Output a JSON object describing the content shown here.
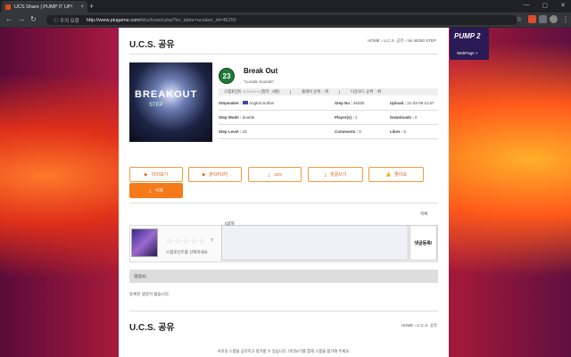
{
  "browser": {
    "tab_title": "UCS Share | PUMP IT UP!",
    "tab_close": "×",
    "new_tab": "+",
    "url_warning": "ⓘ 주의 요함",
    "url_host": "http://www.piugame.com",
    "url_path": "/bbs/board.php?bo_table=ucs&wr_id=46250"
  },
  "header": {
    "title": "U.C.S. 공유",
    "breadcrumb": "HOME  ›  U.C.S. 공유  ›  No.46250 STEP"
  },
  "logo": {
    "text": "PUMP 2",
    "label": "WebPage >"
  },
  "song": {
    "cover_text": "BREAKOUT",
    "cover_sub": "STEP",
    "level": "23",
    "title": "Break Out",
    "subtitle": "\"Lunatic Sounds\"",
    "stats": [
      "스텝포인트 ☆☆☆☆☆ (평가 : 0명)",
      "|",
      "플레이 순위 : -위",
      "|",
      "다운로드 순위 : -위"
    ],
    "stepmaker_label": "Stepmaker :",
    "stepmaker": "AngKimoothie",
    "stepno_label": "Step No :",
    "stepno": "46250",
    "upload_label": "Upload :",
    "upload": "21-02-09 11:57",
    "mode_label": "Step Mode :",
    "mode": "double",
    "players_label": "Player(s) :",
    "players": "1",
    "downloads_label": "Downloads :",
    "downloads": "0",
    "level_label": "Step Level :",
    "level_val": "23",
    "comments_label": "Comments :",
    "comments": "0",
    "likes_label": "Likes :",
    "likes": "0"
  },
  "buttons": {
    "preview": "미리보기",
    "popup": "[POPUP]",
    "ucs": ".ucs",
    "comment": "댓글쓰기",
    "like": "좋아요",
    "delete": "삭제",
    "list": "목록"
  },
  "tabs": {
    "ucs_info": "U.C.S. 설명",
    "comments": "댓글"
  },
  "comment": {
    "stars": "☆☆☆☆☆",
    "star_hint": "?",
    "rate_label": "스텝포인트를 선택하세요",
    "counter": "0글자",
    "submit": "댓글등록!",
    "list_header": "댓글(0)",
    "empty": "등록된 댓글이 없습니다."
  },
  "footer": {
    "title": "U.C.S. 공유",
    "breadcrumb": "HOME  ›  U.C.S. 공유",
    "note": "서로의 스텝을 공유하고 평가할 수 있습니다. 미리보기를 통해 스텝을 평가해 주세요."
  }
}
